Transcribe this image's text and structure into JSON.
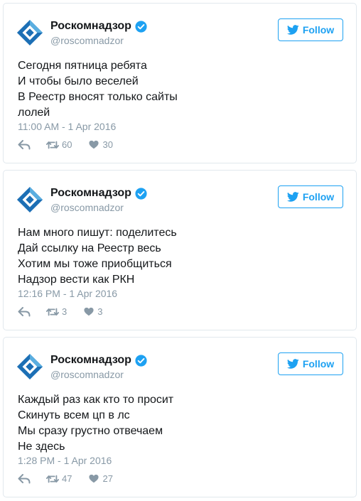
{
  "colors": {
    "accent": "#1da1f2",
    "muted": "#8899a6",
    "border": "#e1e8ed",
    "logo": "#1c6fb5"
  },
  "tweets": [
    {
      "author": {
        "name": "Роскомнадзор",
        "handle": "@roscomnadzor",
        "verified": true,
        "avatar_icon": "roskomnadzor-logo-icon"
      },
      "follow_label": "Follow",
      "lines": [
        "Сегодня пятница ребята",
        "И чтобы было веселей",
        "В Реестр вносят только сайты",
        "лолей"
      ],
      "timestamp": "11:00 AM - 1 Apr 2016",
      "retweets": "60",
      "likes": "30"
    },
    {
      "author": {
        "name": "Роскомнадзор",
        "handle": "@roscomnadzor",
        "verified": true,
        "avatar_icon": "roskomnadzor-logo-icon"
      },
      "follow_label": "Follow",
      "lines": [
        "Нам много пишут: поделитесь",
        "Дай ссылку на Реестр весь",
        "Хотим мы тоже приобщиться",
        "Надзор вести как РКН"
      ],
      "timestamp": "12:16 PM - 1 Apr 2016",
      "retweets": "3",
      "likes": "3"
    },
    {
      "author": {
        "name": "Роскомнадзор",
        "handle": "@roscomnadzor",
        "verified": true,
        "avatar_icon": "roskomnadzor-logo-icon"
      },
      "follow_label": "Follow",
      "lines": [
        "Каждый раз как кто то просит",
        "Скинуть всем цп в лс",
        "Мы сразу грустно отвечаем",
        "Не здесь"
      ],
      "timestamp": "1:28 PM - 1 Apr 2016",
      "retweets": "47",
      "likes": "27"
    }
  ]
}
